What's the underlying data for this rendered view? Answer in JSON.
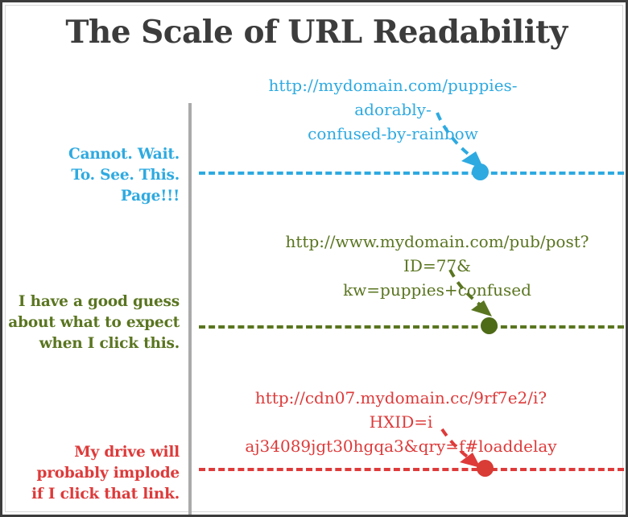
{
  "page": {
    "title": "The Scale of URL Readability",
    "title_color": "#3c3c3c",
    "background": "#ffffff",
    "border_color": "#3c3c3c",
    "axis_color": "#aaaaaa"
  },
  "levels": [
    {
      "id": "readable",
      "label_lines": [
        "Cannot. Wait.",
        "To. See. This.",
        "Page!!!"
      ],
      "color": "#2eaae1",
      "dot_color": "#2eaae1",
      "url_lines": [
        "http://mydomain.com/puppies-adorably-",
        "confused-by-rainbow"
      ],
      "url_full": "http://mydomain.com/puppies-adorably-confused-by-rainbow"
    },
    {
      "id": "guessable",
      "label_lines": [
        "I have a good guess",
        "about what to expect",
        "when I click this."
      ],
      "color": "#5a7520",
      "dot_color": "#4e6b18",
      "url_lines": [
        "http://www.mydomain.com/pub/post?ID=77&",
        "kw=puppies+confused"
      ],
      "url_full": "http://www.mydomain.com/pub/post?ID=77&kw=puppies+confused"
    },
    {
      "id": "unreadable",
      "label_lines": [
        "My drive will",
        "probably implode",
        "if I click that link."
      ],
      "color": "#de3a3a",
      "dot_color": "#d93b35",
      "url_lines": [
        "http://cdn07.mydomain.cc/9rf7e2/i?HXID=i",
        "aj34089jgt30hgqa3&qry=f#loaddelay"
      ],
      "url_full": "http://cdn07.mydomain.cc/9rf7e2/i?HXID=iaj34089jgt30hgqa3&qry=f#loaddelay"
    }
  ]
}
